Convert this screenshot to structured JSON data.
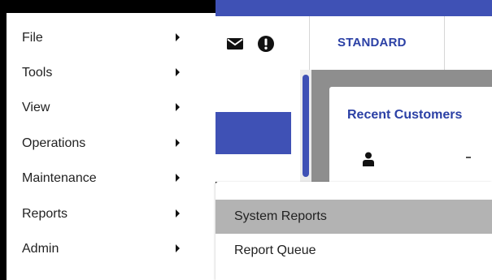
{
  "main_menu": {
    "items": [
      {
        "label": "File"
      },
      {
        "label": "Tools"
      },
      {
        "label": "View"
      },
      {
        "label": "Operations"
      },
      {
        "label": "Maintenance"
      },
      {
        "label": "Reports"
      },
      {
        "label": "Admin"
      }
    ],
    "submenu_icon": "chevron-right-icon"
  },
  "reports_submenu": {
    "items": [
      {
        "label": "System Reports",
        "highlighted": true
      },
      {
        "label": "Report Queue",
        "highlighted": false
      }
    ]
  },
  "header": {
    "icons": [
      "mail-icon",
      "alert-icon"
    ],
    "tab_standard_label": "STANDARD"
  },
  "dashboard": {
    "card_title": "Recent Customers",
    "card_icon": "user-icon"
  },
  "colors": {
    "accent": "#3f51b5",
    "accent_text": "#2b40a5",
    "highlight": "#b3b3b3",
    "overlay": "#8e8e8e"
  }
}
